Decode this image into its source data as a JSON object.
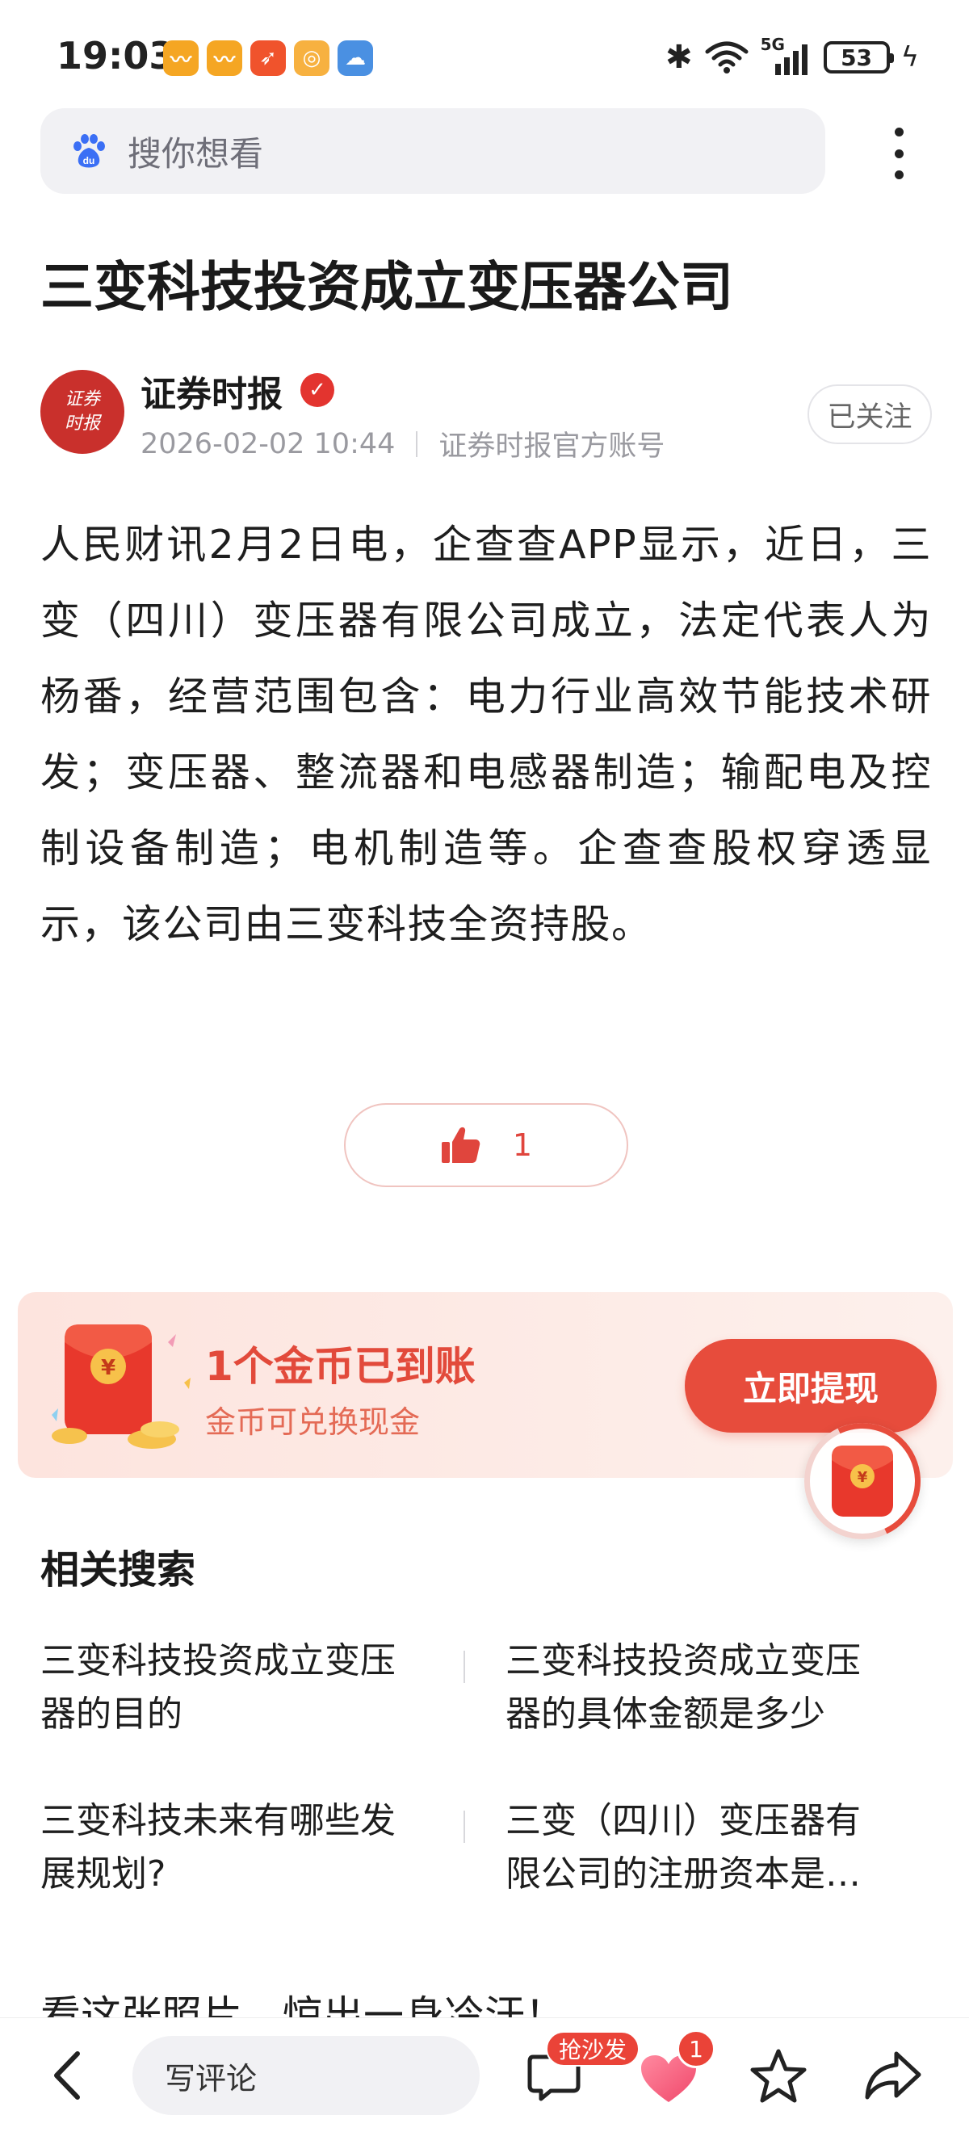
{
  "status_bar": {
    "time": "19:03",
    "battery": "53",
    "network": "5G"
  },
  "search": {
    "placeholder": "搜你想看"
  },
  "article": {
    "title": "三变科技投资成立变压器公司",
    "author": {
      "name": "证券时报",
      "avatar_text": "证券时报",
      "date": "2026-02-02 10:44",
      "account_type": "证券时报官方账号",
      "follow_label": "已关注"
    },
    "body": "人民财讯2月2日电，企查查APP显示，近日，三变（四川）变压器有限公司成立，法定代表人为杨番，经营范围包含：电力行业高效节能技术研发；变压器、整流器和电感器制造；输配电及控制设备制造；电机制造等。企查查股权穿透显示，该公司由三变科技全资持股。",
    "likes": "1"
  },
  "coin_banner": {
    "title": "1个金币已到账",
    "subtitle": "金币可兑换现金",
    "button_label": "立即提现"
  },
  "related": {
    "title": "相关搜索",
    "items": [
      {
        "text": "三变科技投资成立变压器的目的"
      },
      {
        "text": "三变科技投资成立变压器的具体金额是多少"
      },
      {
        "text": "三变科技未来有哪些发展规划?"
      },
      {
        "text": "三变（四川）变压器有限公司的注册资本是多少"
      }
    ]
  },
  "next_headline": "看这张照片，惊出一身冷汗！",
  "bottom_bar": {
    "comment_placeholder": "写评论",
    "sofa_badge": "抢沙发",
    "heart_count": "1"
  },
  "colors": {
    "accent": "#e74c3c",
    "banner_bg": "#fde4de"
  }
}
